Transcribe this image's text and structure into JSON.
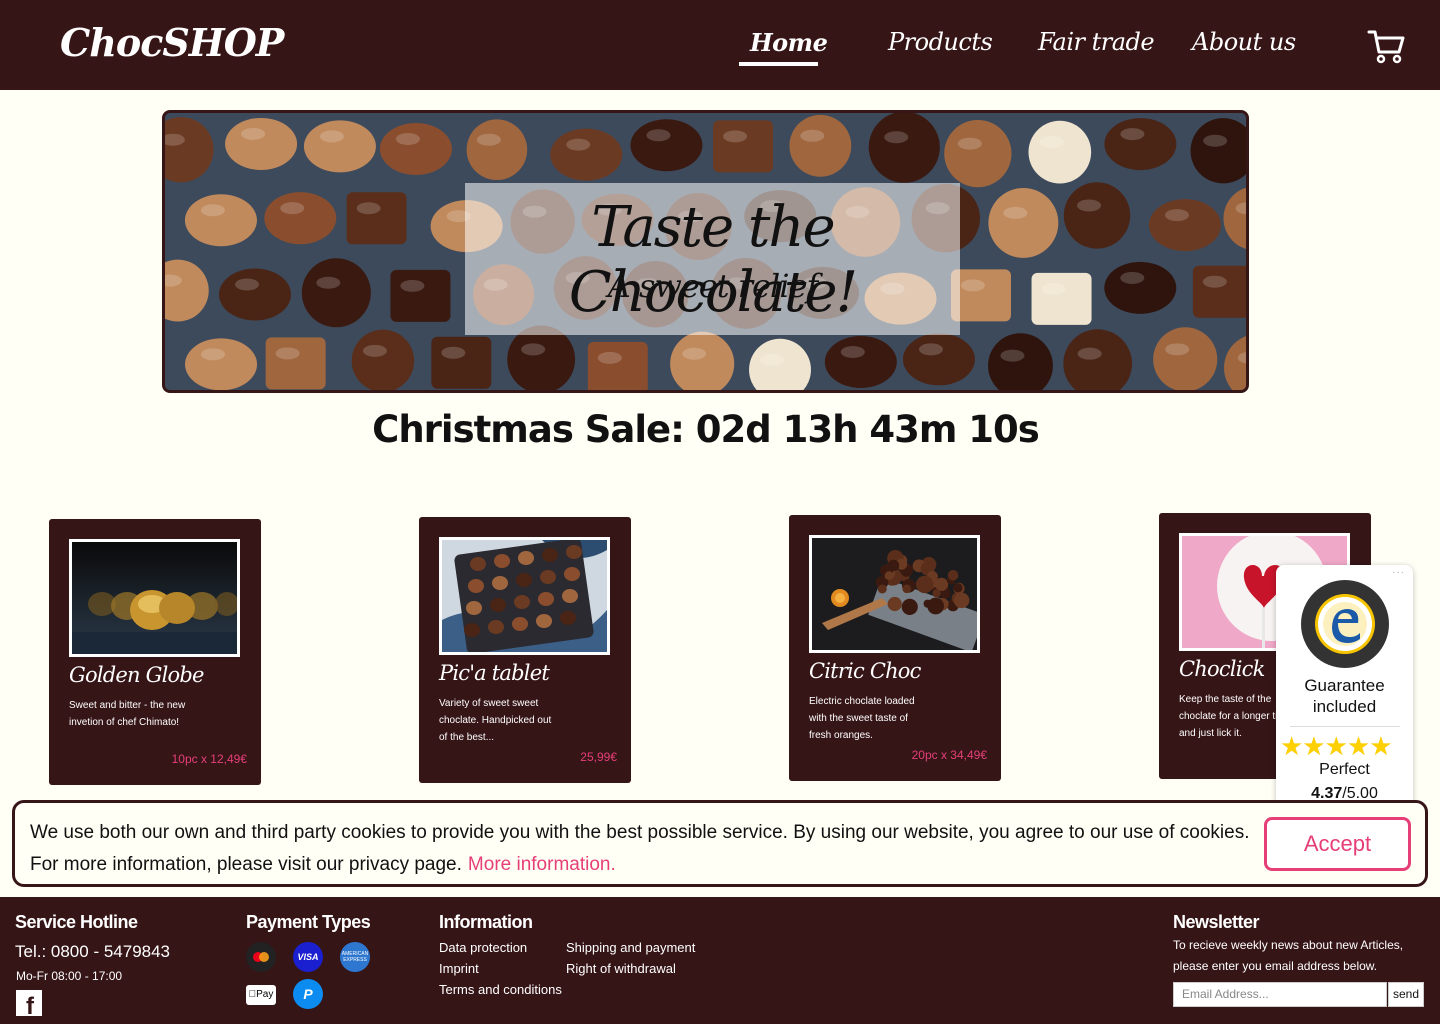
{
  "header": {
    "logo": "ChocSHOP",
    "nav": [
      {
        "label": "Home",
        "active": true
      },
      {
        "label": "Products"
      },
      {
        "label": "Fair trade"
      },
      {
        "label": "About us"
      }
    ],
    "cart_icon": "shopping-cart-icon"
  },
  "hero": {
    "title": "Taste the Chocolate!",
    "subtitle": "A sweet relief"
  },
  "sale": {
    "label": "Christmas Sale: 02d 13h 43m 10s"
  },
  "products": [
    {
      "name": "Golden Globe",
      "desc": "Sweet and bitter - the new invetion of chef Chimato!",
      "price": "10pc x 12,49€"
    },
    {
      "name": "Pic'a tablet",
      "desc": "Variety of sweet sweet choclate. Handpicked out of the best...",
      "price": "25,99€"
    },
    {
      "name": "Citric Choc",
      "desc": "Electric choclate loaded with the sweet taste of fresh oranges.",
      "price": "20pc x 34,49€"
    },
    {
      "name": "Choclick",
      "desc": "Keep the taste of the choclate for a longer time and just lick it.",
      "price": ""
    }
  ],
  "trust_badge": {
    "guarantee": "Guarantee included",
    "stars_icon": "star-rating-icon",
    "rating_value": 4.37,
    "rating_label": "Perfect",
    "score": "4.37",
    "score_max": "/5.00"
  },
  "cookie": {
    "text_line1": "We use both our own and third party cookies to provide you with the best possible service. By using our website, you agree to our use of cookies.",
    "text_line2": "For more information, please visit our privacy page.",
    "link": "More information.",
    "accept": "Accept"
  },
  "footer": {
    "hotline_title": "Service Hotline",
    "phone": "Tel.: 0800 - 5479843",
    "hours": "Mo-Fr 08:00 - 17:00",
    "payment_title": "Payment Types",
    "payment_icons": [
      "mastercard-icon",
      "visa-icon",
      "amex-icon",
      "apple-pay-icon",
      "paypal-icon"
    ],
    "visa": "VISA",
    "amex": "AMERICAN EXPRESS",
    "applepay": "Pay",
    "paypal": "P",
    "info_title": "Information",
    "info_links": [
      "Data protection",
      "Imprint",
      "Terms and conditions",
      "Shipping and payment",
      "Right of withdrawal"
    ],
    "newsletter_title": "Newsletter",
    "newsletter_text1": "To recieve weekly news about new Articles,",
    "newsletter_text2": "please enter you email address below.",
    "email_placeholder": "Email Address...",
    "send": "send"
  },
  "colors": {
    "brand": "#361517",
    "accent": "#e63f78",
    "background": "#fffff6"
  }
}
